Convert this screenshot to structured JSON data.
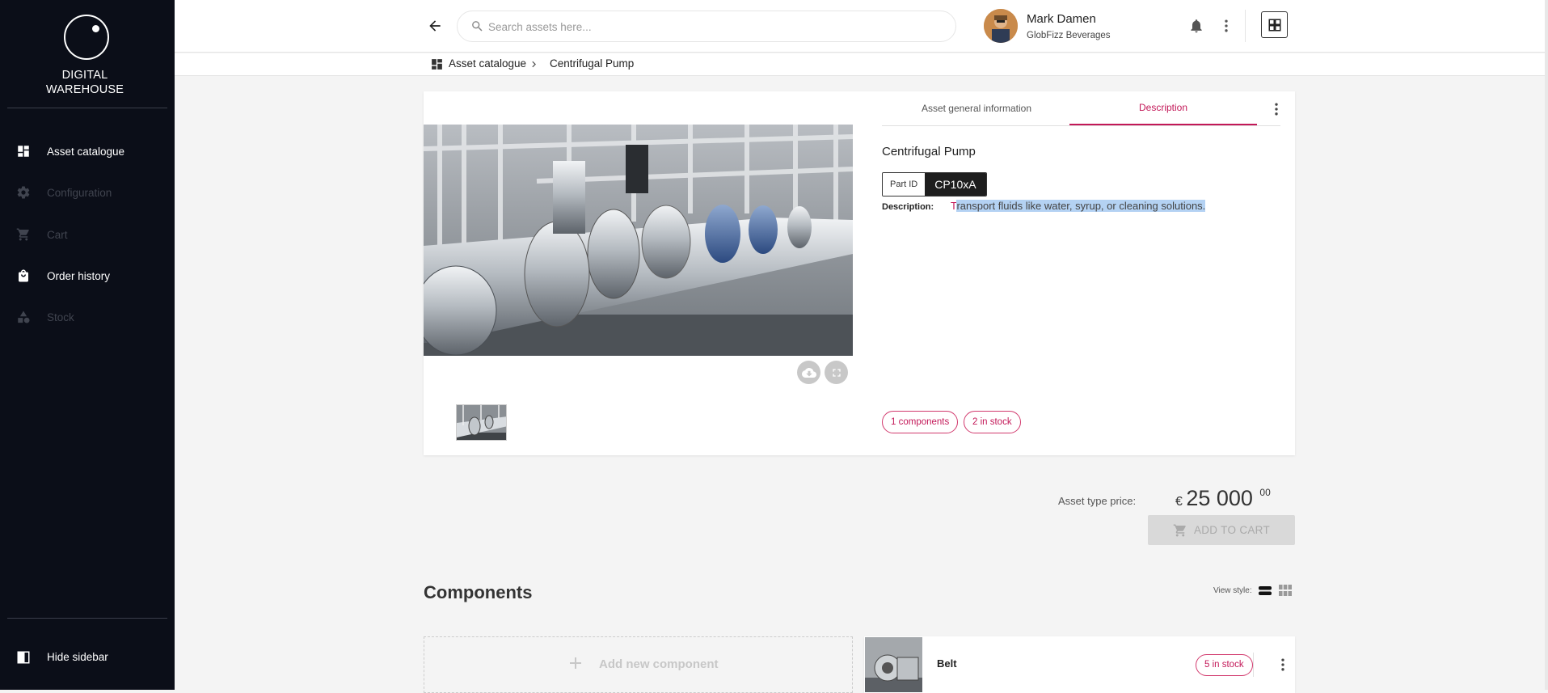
{
  "sidebar": {
    "logo_line1": "DIGITAL",
    "logo_line2": "WAREHOUSE",
    "items": [
      {
        "label": "Asset catalogue",
        "icon": "dashboard-icon",
        "enabled": true
      },
      {
        "label": "Configuration",
        "icon": "gear-icon",
        "enabled": false
      },
      {
        "label": "Cart",
        "icon": "cart-icon",
        "enabled": false
      },
      {
        "label": "Order history",
        "icon": "shopping-bag-icon",
        "enabled": true
      },
      {
        "label": "Stock",
        "icon": "stock-icon",
        "enabled": false
      }
    ],
    "hide_label": "Hide sidebar"
  },
  "header": {
    "search_placeholder": "Search assets here...",
    "user_name": "Mark Damen",
    "user_company": "GlobFizz Beverages"
  },
  "breadcrumb": {
    "root": "Asset catalogue",
    "current": "Centrifugal Pump"
  },
  "product": {
    "tabs": [
      "Asset general information",
      "Description"
    ],
    "active_tab": "Description",
    "title": "Centrifugal Pump",
    "part_id_label": "Part ID",
    "part_id_value": "CP10xA",
    "description_label": "Description:",
    "description_first": "T",
    "description_rest": "ransport fluids like water, syrup, or cleaning solutions.",
    "components_chip": "1 components",
    "stock_chip": "2 in stock"
  },
  "price": {
    "label": "Asset type price:",
    "currency": "€",
    "amount": "25 000",
    "cents": "00",
    "add_to_cart": "ADD TO CART"
  },
  "components": {
    "heading": "Components",
    "view_style_label": "View style:",
    "add_new_label": "Add new component",
    "items": [
      {
        "name": "Belt",
        "stock": "5 in stock"
      }
    ]
  },
  "colors": {
    "accent": "#c31858",
    "sidebar_bg": "#0b0e18"
  }
}
